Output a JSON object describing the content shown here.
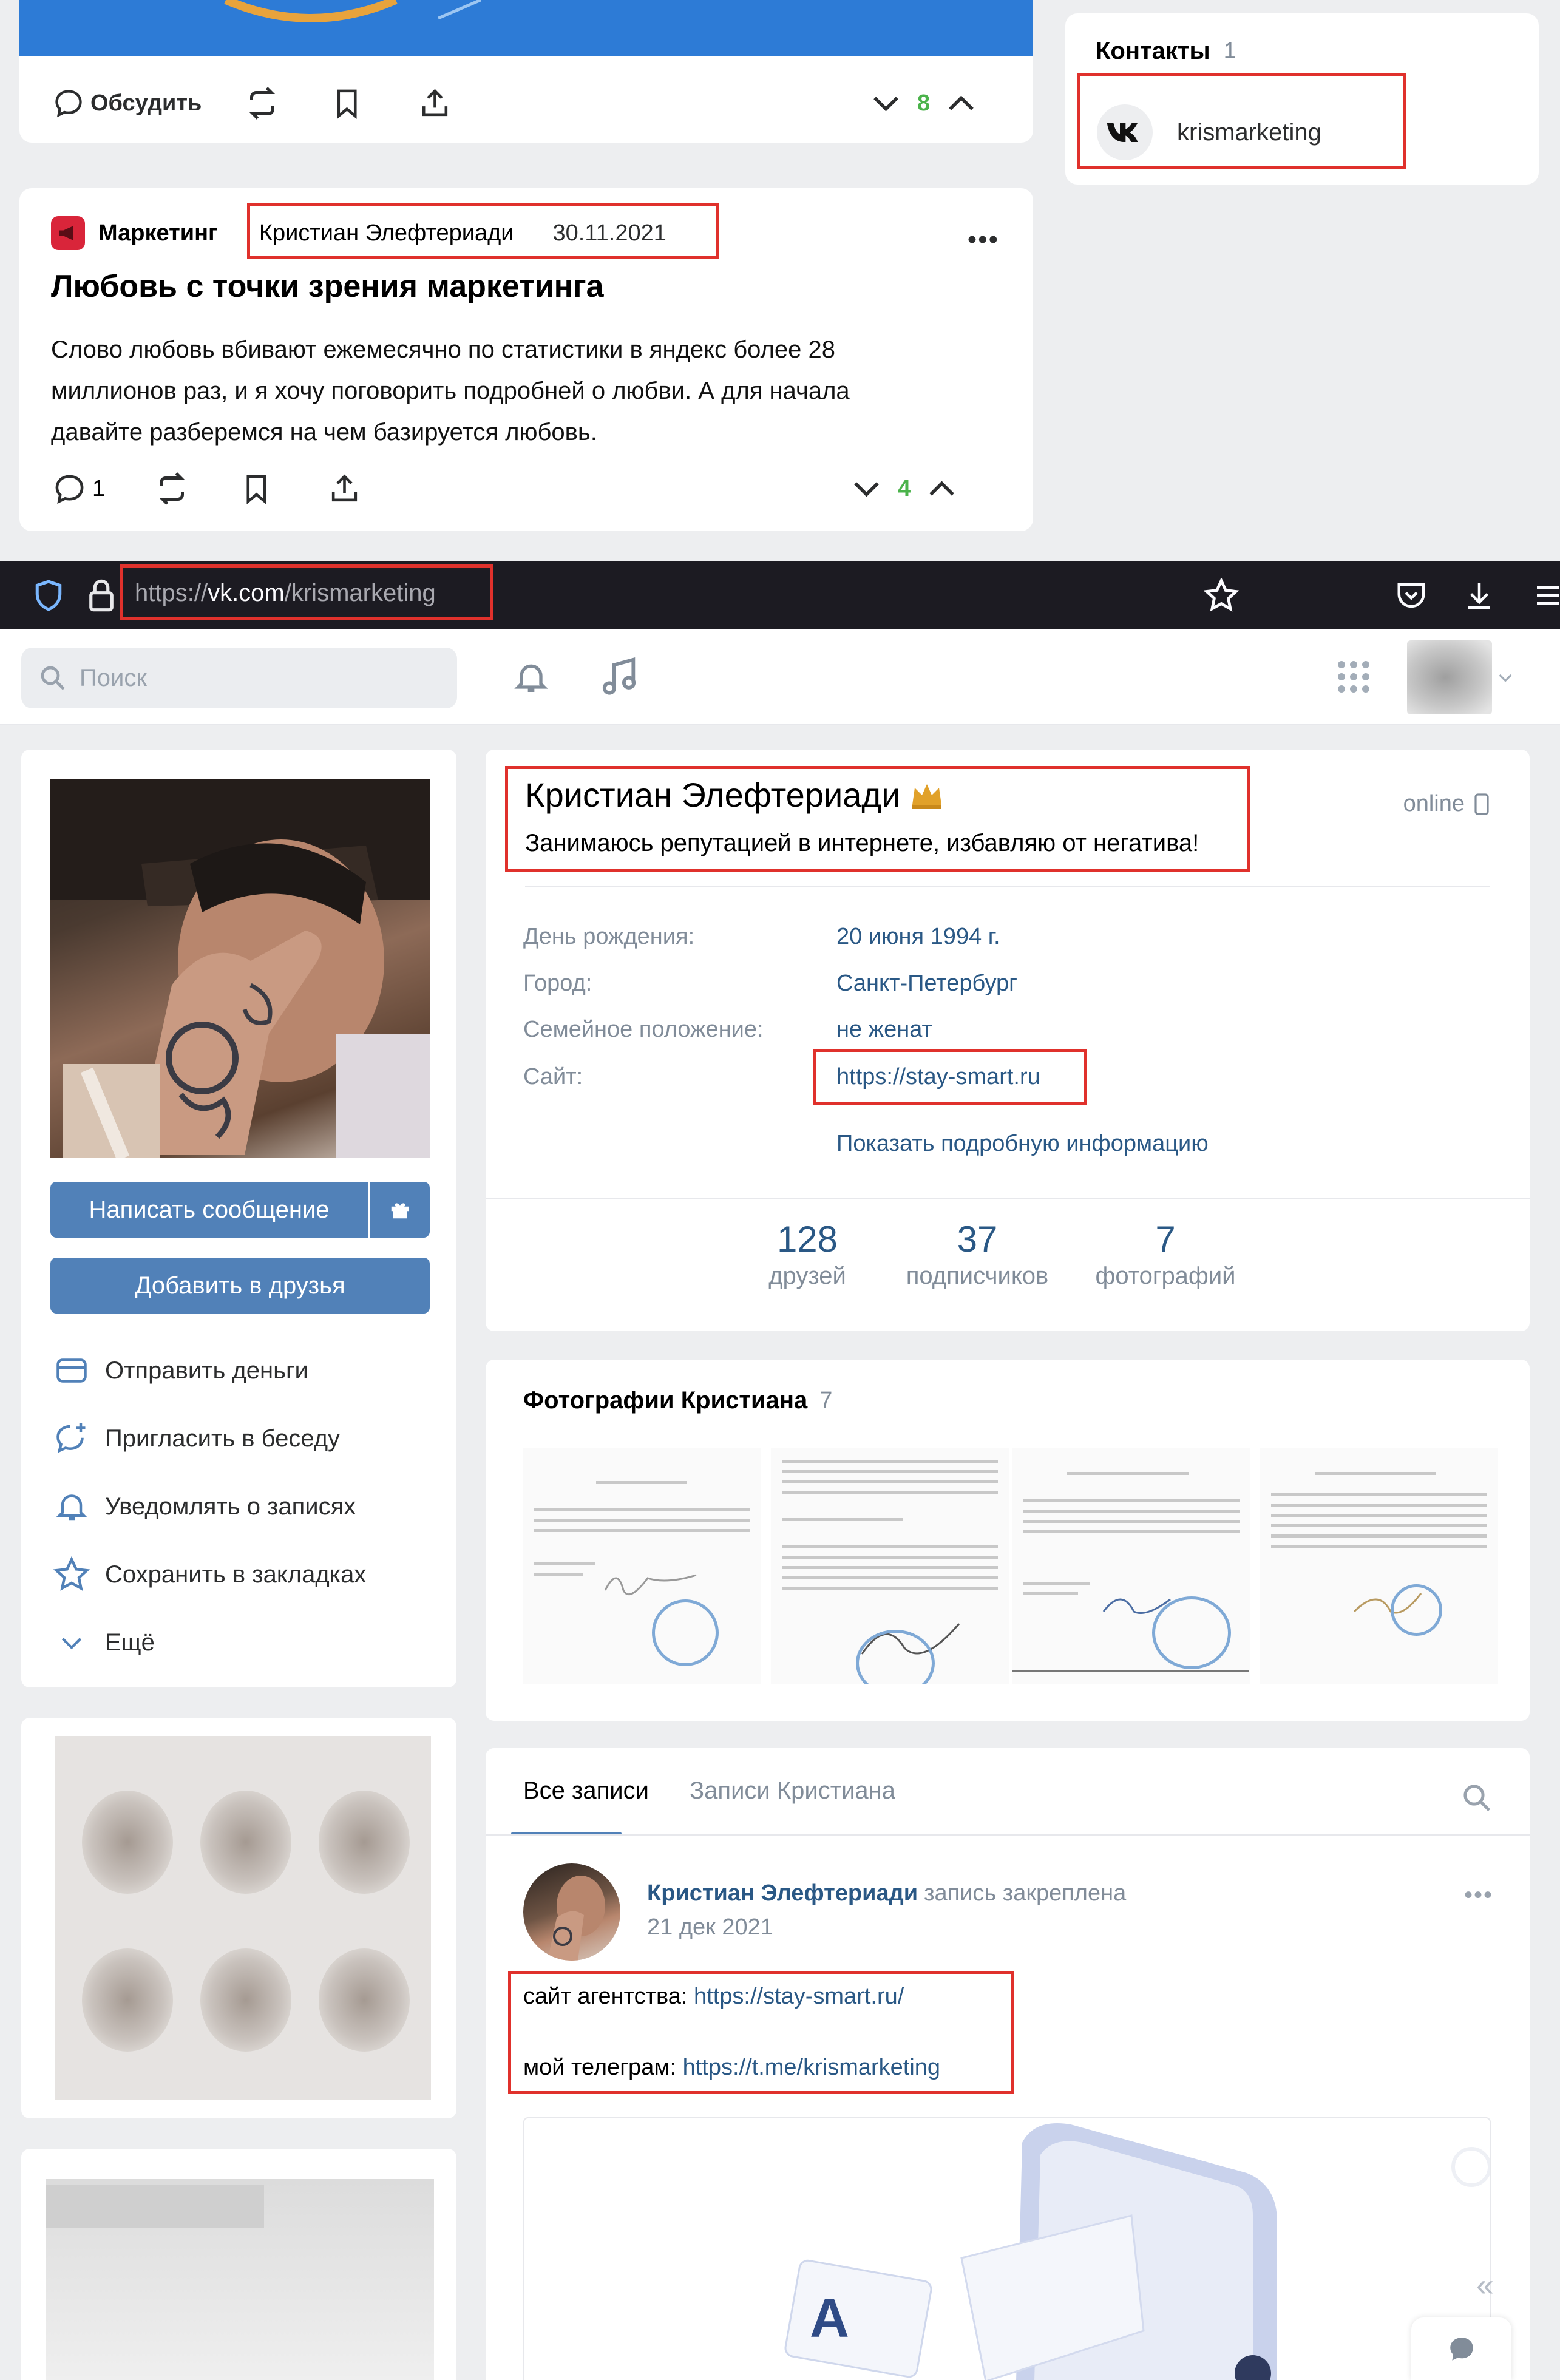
{
  "post1": {
    "discuss": "Обсудить",
    "rating": "8"
  },
  "contacts": {
    "title": "Контакты",
    "count": "1",
    "name": "krismarketing"
  },
  "post2": {
    "community": "Маркетинг",
    "author": "Кристиан Элефтериади",
    "date": "30.11.2021",
    "title": "Любовь с точки зрения маркетинга",
    "line1": "Слово любовь вбивают ежемесячно по статистики в яндекс более 28",
    "line2": "миллионов раз, и я хочу поговорить подробней о любви. А для начала",
    "line3": "давайте разберемся на чем базируется любовь.",
    "comments": "1",
    "rating": "4"
  },
  "browser": {
    "url_prefix": "https://",
    "url_domain": "vk.com",
    "url_path": "/krismarketing"
  },
  "vk_header": {
    "search_placeholder": "Поиск"
  },
  "profile": {
    "name": "Кристиан Элефтериади",
    "status": "Занимаюсь репутацией в интернете, избавляю от негатива!",
    "online": "online",
    "fields": [
      {
        "label": "День рождения:",
        "value": "20 июня 1994 г."
      },
      {
        "label": "Город:",
        "value": "Санкт-Петербург"
      },
      {
        "label": "Семейное положение:",
        "value": "не женат"
      },
      {
        "label": "Сайт:",
        "value": "https://stay-smart.ru"
      }
    ],
    "show_more": "Показать подробную информацию",
    "counters": [
      {
        "value": "128",
        "label": "друзей"
      },
      {
        "value": "37",
        "label": "подписчиков"
      },
      {
        "value": "7",
        "label": "фотографий"
      }
    ]
  },
  "left": {
    "write_message": "Написать сообщение",
    "add_friend": "Добавить в друзья",
    "menu": [
      "Отправить деньги",
      "Пригласить в беседу",
      "Уведомлять о записях",
      "Сохранить в закладках",
      "Ещё"
    ]
  },
  "photos": {
    "title": "Фотографии Кристиана",
    "count": "7"
  },
  "wall": {
    "tab_all": "Все записи",
    "tab_own": "Записи Кристиана",
    "author": "Кристиан Элефтериади",
    "pinned": "запись закреплена",
    "date": "21 дек 2021",
    "agency_label": "сайт агентства: ",
    "agency_link": "https://stay-smart.ru/",
    "tg_label": "мой телеграм: ",
    "tg_link": "https://t.me/krismarketing"
  },
  "colors": {
    "vk_blue": "#5181b8",
    "link": "#2a5885",
    "highlight": "#e0312c",
    "rating_green": "#4bb34b",
    "browser_bar": "#1c1b22"
  }
}
